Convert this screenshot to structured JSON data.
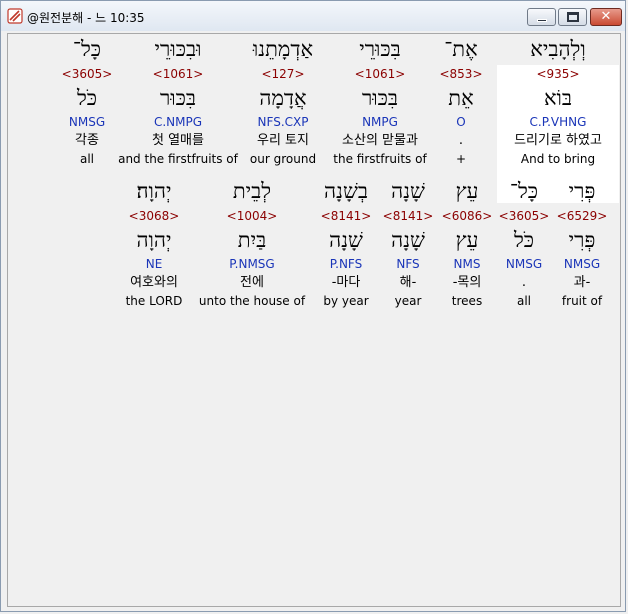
{
  "window": {
    "title": "@원전분해 - 느 10:35",
    "close_glyph": "✕"
  },
  "rows": [
    [
      {
        "heb": "וְלְהָבִיא",
        "strong": "<935>",
        "lemma": "בּוֹא",
        "parse": "C.P.VHNG",
        "korean": "드리기로 하였고",
        "english": "And to bring",
        "highlighted": true
      },
      {
        "heb": "אֶת־",
        "strong": "<853>",
        "lemma": "אֵת",
        "parse": "O",
        "korean": ".",
        "english": "+"
      },
      {
        "heb": "בִּכּוּרֵי",
        "strong": "<1061>",
        "lemma": "בִּכּוּר",
        "parse": "NMPG",
        "korean": "소산의 맏물과",
        "english": "the firstfruits of"
      },
      {
        "heb": "אַדְמָתֵנוּ",
        "strong": "<127>",
        "lemma": "אֲדָמָה",
        "parse": "NFS.CXP",
        "korean": "우리 토지",
        "english": "our ground"
      },
      {
        "heb": "וּבִכּוּרֵי",
        "strong": "<1061>",
        "lemma": "בִּכּוּר",
        "parse": "C.NMPG",
        "korean": "첫 열매를",
        "english": "and the firstfruits of"
      },
      {
        "heb": "כָּל־",
        "strong": "<3605>",
        "lemma": "כֹּל",
        "parse": "NMSG",
        "korean": "각종",
        "english": "all"
      }
    ],
    [
      {
        "heb": "פְּרִי",
        "strong": "<6529>",
        "lemma": "פְּרִי",
        "parse": "NMSG",
        "korean": "과-",
        "english": "fruit of"
      },
      {
        "heb": "כָּל־",
        "strong": "<3605>",
        "lemma": "כֹּל",
        "parse": "NMSG",
        "korean": ".",
        "english": "all"
      },
      {
        "heb": "עֵץ",
        "strong": "<6086>",
        "lemma": "עֵץ",
        "parse": "NMS",
        "korean": "-목의",
        "english": "trees"
      },
      {
        "heb": "שָׁנָה",
        "strong": "<8141>",
        "lemma": "שָׁנָה",
        "parse": "NFS",
        "korean": "해-",
        "english": "year"
      },
      {
        "heb": "בְשָׁנָה",
        "strong": "<8141>",
        "lemma": "שָׁנָה",
        "parse": "P.NFS",
        "korean": "-마다",
        "english": "by year"
      },
      {
        "heb": "לְבֵית",
        "strong": "<1004>",
        "lemma": "בַּיִת",
        "parse": "P.NMSG",
        "korean": "전에",
        "english": "unto the house of"
      },
      {
        "heb": "יְהוָה׃",
        "strong": "<3068>",
        "lemma": "יְהוָה",
        "parse": "NE",
        "korean": "여호와의",
        "english": "the LORD"
      }
    ]
  ]
}
